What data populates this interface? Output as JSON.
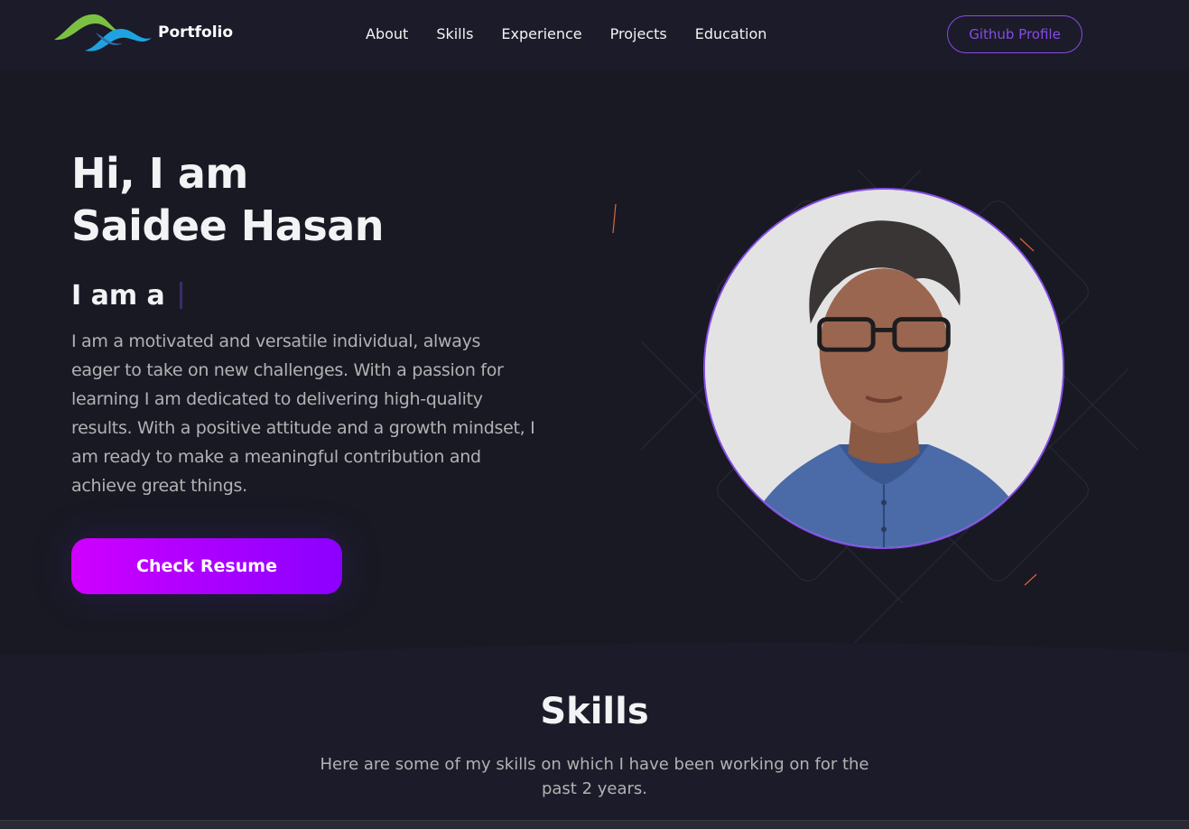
{
  "nav": {
    "logo_text": "Portfolio",
    "links": [
      "About",
      "Skills",
      "Experience",
      "Projects",
      "Education"
    ],
    "github_label": "Github Profile"
  },
  "hero": {
    "greeting_line1": "Hi, I am",
    "greeting_line2": "Saidee Hasan",
    "role_prefix": "I am a",
    "bio_lines": [
      "I am a motivated and versatile individual, always",
      "eager to take on new challenges. With a passion for",
      "learning I am dedicated to delivering high-quality",
      "results. With a positive attitude and a growth mindset, I",
      "am ready to make a meaningful contribution and",
      "achieve great things."
    ],
    "cta_label": "Check Resume"
  },
  "skills": {
    "title": "Skills",
    "desc_lines": [
      "Here are some of my skills on which I have been working on for the",
      "past 2 years."
    ]
  },
  "colors": {
    "accent": "#854ce6",
    "background": "#191924",
    "cta_start": "#d000ff",
    "cta_end": "#8b00ff",
    "text_secondary": "#b1b2b3"
  }
}
